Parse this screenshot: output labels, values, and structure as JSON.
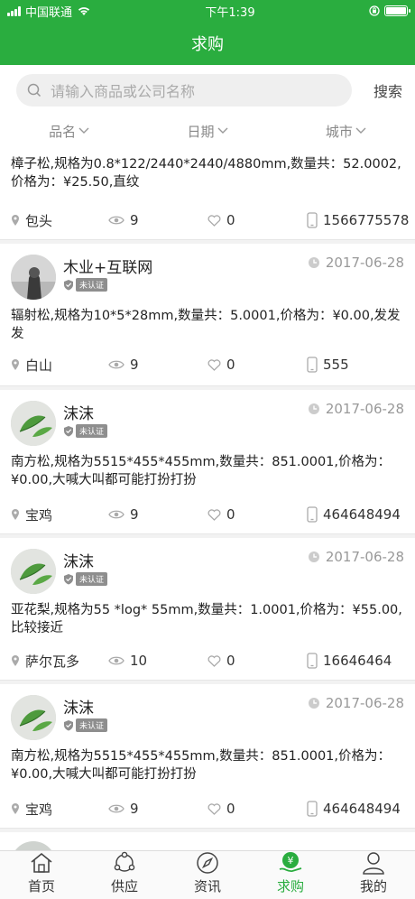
{
  "status_bar": {
    "carrier": "中国联通",
    "time": "下午1:39"
  },
  "header": {
    "title": "求购"
  },
  "search": {
    "placeholder": "请输入商品或公司名称",
    "button": "搜索"
  },
  "filters": [
    {
      "label": "品名"
    },
    {
      "label": "日期"
    },
    {
      "label": "城市"
    }
  ],
  "badge_label": "未认证",
  "posts": [
    {
      "user": "",
      "date": "",
      "desc": "樟子松,规格为0.8*122/2440*2440/4880mm,数量共：52.0002,价格为：¥25.50,直纹",
      "location": "包头",
      "views": "9",
      "likes": "0",
      "phone": "1566775578"
    },
    {
      "user": "木业+互联网",
      "date": "2017-06-28",
      "desc": "辐射松,规格为10*5*28mm,数量共：5.0001,价格为：¥0.00,发发发",
      "location": "白山",
      "views": "9",
      "likes": "0",
      "phone": "555"
    },
    {
      "user": "沫沫",
      "date": "2017-06-28",
      "desc": "南方松,规格为5515*455*455mm,数量共：851.0001,价格为：¥0.00,大喊大叫都可能打扮打扮",
      "location": "宝鸡",
      "views": "9",
      "likes": "0",
      "phone": "464648494"
    },
    {
      "user": "沫沫",
      "date": "2017-06-28",
      "desc": "亚花梨,规格为55 *log* 55mm,数量共：1.0001,价格为：¥55.00,比较接近",
      "location": "萨尔瓦多",
      "views": "10",
      "likes": "0",
      "phone": "16646464"
    },
    {
      "user": "沫沫",
      "date": "2017-06-28",
      "desc": "南方松,规格为5515*455*455mm,数量共：851.0001,价格为：¥0.00,大喊大叫都可能打扮打扮",
      "location": "宝鸡",
      "views": "9",
      "likes": "0",
      "phone": "464648494"
    }
  ],
  "tabs": [
    {
      "label": "首页",
      "icon": "home-icon"
    },
    {
      "label": "供应",
      "icon": "share-icon"
    },
    {
      "label": "资讯",
      "icon": "compass-icon"
    },
    {
      "label": "求购",
      "icon": "yuan-icon",
      "active": true
    },
    {
      "label": "我的",
      "icon": "user-icon"
    }
  ],
  "colors": {
    "brand": "#2aad3f",
    "muted": "#999999"
  }
}
